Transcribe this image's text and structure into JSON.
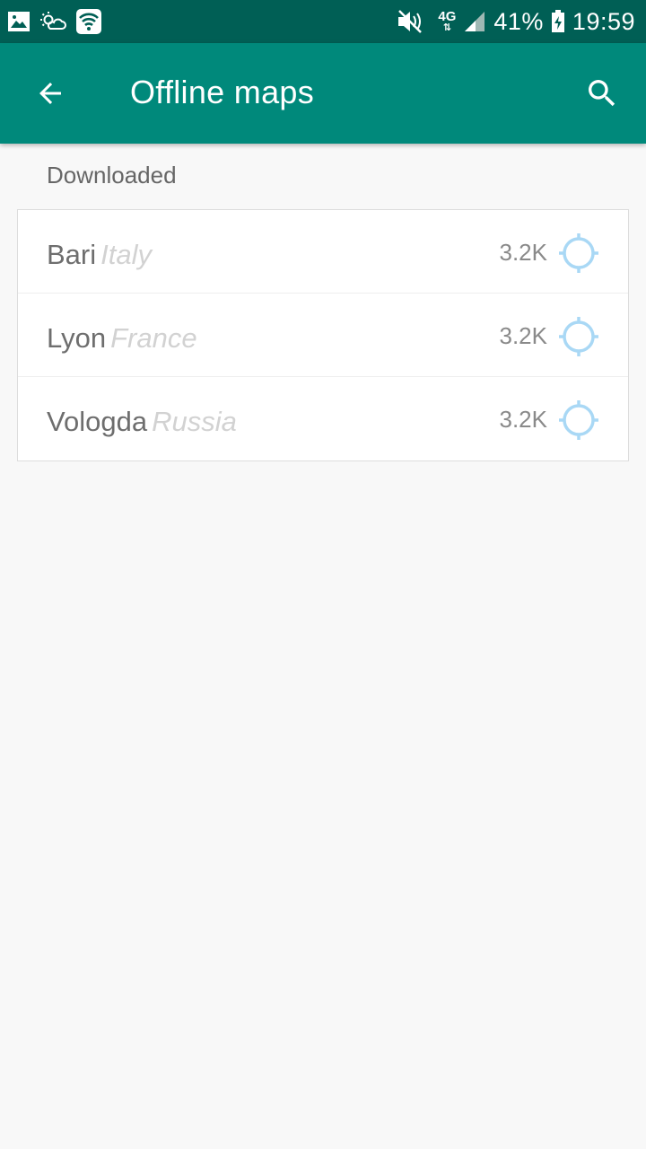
{
  "status_bar": {
    "battery": "41%",
    "time": "19:59",
    "network": "4G",
    "icons": [
      "gallery-icon",
      "weather-icon",
      "wifi-icon",
      "mute-icon",
      "signal-icon",
      "battery-charging-icon"
    ]
  },
  "app_bar": {
    "title": "Offline maps",
    "back_icon": "arrow-back-icon",
    "search_icon": "search-icon"
  },
  "section": {
    "title": "Downloaded"
  },
  "maps": [
    {
      "city": "Bari",
      "country": "Italy",
      "size": "3.2K"
    },
    {
      "city": "Lyon",
      "country": "France",
      "size": "3.2K"
    },
    {
      "city": "Vologda",
      "country": "Russia",
      "size": "3.2K"
    }
  ],
  "colors": {
    "status_bar": "#005f55",
    "app_bar": "#00897b",
    "locate_icon": "#a9d8f5"
  }
}
